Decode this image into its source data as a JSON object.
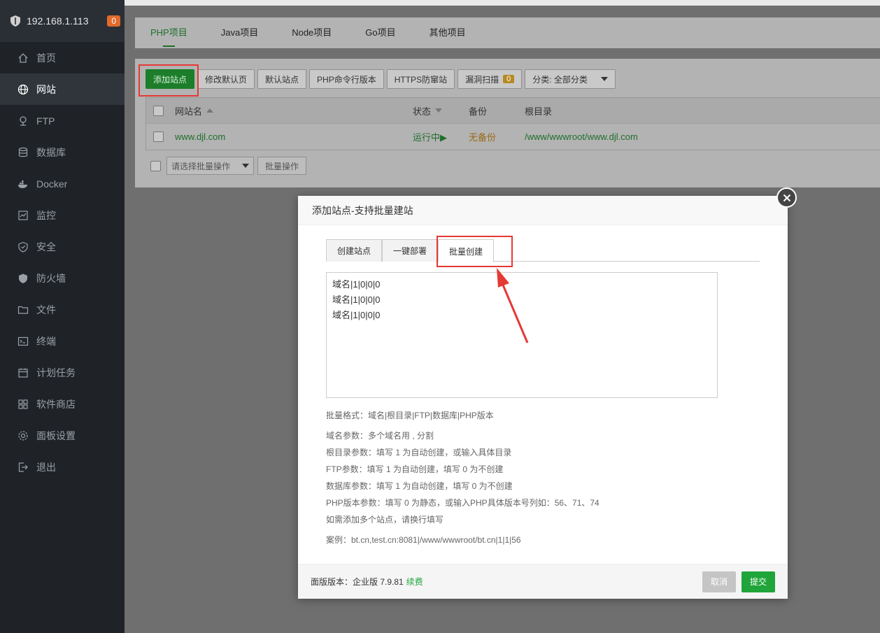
{
  "sidebar": {
    "host": "192.168.1.113",
    "badge": "0",
    "items": [
      {
        "label": "首页",
        "icon": "home-icon"
      },
      {
        "label": "网站",
        "icon": "globe-icon"
      },
      {
        "label": "FTP",
        "icon": "ftp-icon"
      },
      {
        "label": "数据库",
        "icon": "database-icon"
      },
      {
        "label": "Docker",
        "icon": "docker-icon"
      },
      {
        "label": "监控",
        "icon": "monitor-icon"
      },
      {
        "label": "安全",
        "icon": "shield-icon"
      },
      {
        "label": "防火墙",
        "icon": "firewall-icon"
      },
      {
        "label": "文件",
        "icon": "folder-icon"
      },
      {
        "label": "终端",
        "icon": "terminal-icon"
      },
      {
        "label": "计划任务",
        "icon": "calendar-icon"
      },
      {
        "label": "软件商店",
        "icon": "apps-icon"
      },
      {
        "label": "面板设置",
        "icon": "gear-icon"
      },
      {
        "label": "退出",
        "icon": "logout-icon"
      }
    ]
  },
  "project_tabs": [
    "PHP项目",
    "Java项目",
    "Node项目",
    "Go项目",
    "其他项目"
  ],
  "toolbar": {
    "add_site": "添加站点",
    "modify_default": "修改默认页",
    "default_site": "默认站点",
    "php_cli": "PHP命令行版本",
    "https_guard": "HTTPS防窜站",
    "vuln_scan": "漏洞扫描",
    "vuln_count": "0",
    "category": "分类: 全部分类"
  },
  "table": {
    "headers": {
      "name": "网站名",
      "status": "状态",
      "backup": "备份",
      "root": "根目录"
    },
    "rows": [
      {
        "name": "www.djl.com",
        "status": "运行中▶",
        "backup": "无备份",
        "root": "/www/wwwroot/www.djl.com"
      }
    ]
  },
  "batch": {
    "select_placeholder": "请选择批量操作",
    "button": "批量操作"
  },
  "dialog": {
    "title": "添加站点-支持批量建站",
    "tabs": [
      "创建站点",
      "一键部署",
      "批量创建"
    ],
    "textarea": "域名|1|0|0|0\n域名|1|0|0|0\n域名|1|0|0|0",
    "help": [
      "批量格式：域名|根目录|FTP|数据库|PHP版本",
      "域名参数：多个域名用 , 分割",
      "根目录参数：填写 1 为自动创建，或输入具体目录",
      "FTP参数：填写 1 为自动创建，填写 0 为不创建",
      "数据库参数：填写 1 为自动创建，填写 0 为不创建",
      "PHP版本参数：填写 0 为静态，或输入PHP具体版本号列如：56、71、74",
      "如需添加多个站点，请换行填写",
      "案例：bt.cn,test.cn:8081|/www/wwwroot/bt.cn|1|1|56"
    ],
    "footer_version": "面版版本：企业版 7.9.81",
    "footer_renew": "续费",
    "cancel": "取消",
    "submit": "提交"
  },
  "colors": {
    "accent_green": "#20a53a",
    "annotation_red": "#e53935",
    "sidebar_bg": "#1f2328"
  }
}
